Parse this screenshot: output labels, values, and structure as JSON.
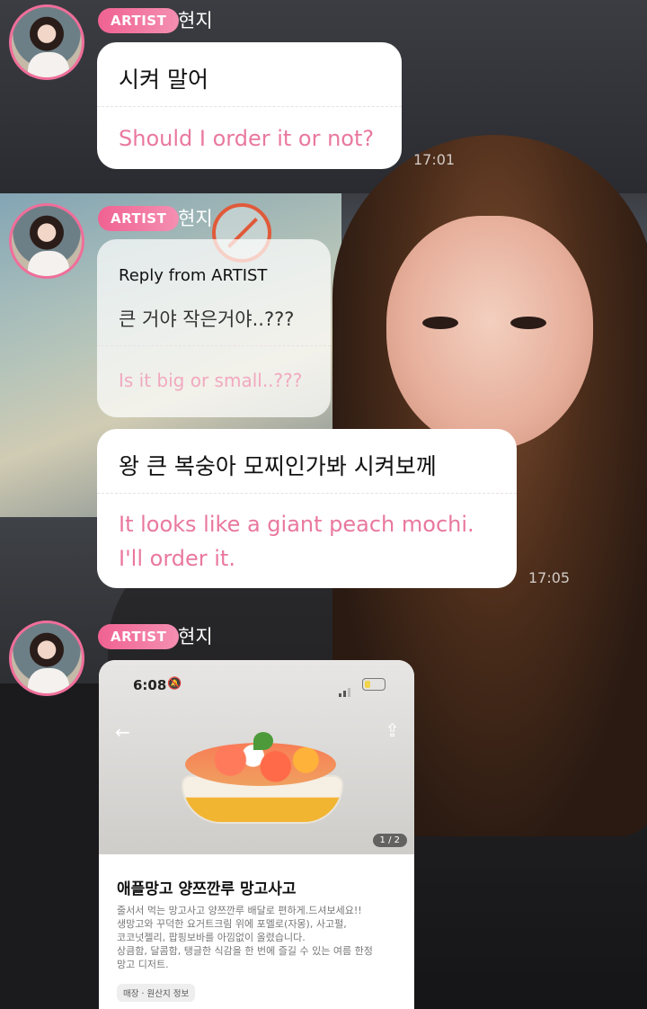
{
  "artist_badge": "ARTIST",
  "artist_name": "현지",
  "messages": [
    {
      "ko": "시켜 말어",
      "en": "Should I order it or not?",
      "time": "17:01"
    },
    {
      "reply_header": "Reply from ARTIST",
      "ko": "큰 거야 작은거야..???",
      "en": "Is it big or small..???"
    },
    {
      "ko": "왕 큰 복숭아 모찌인가봐 시켜보께",
      "en_line1": "It looks like a giant peach mochi.",
      "en_line2": "I'll order it.",
      "time": "17:05"
    }
  ],
  "card": {
    "status_time": "6:08",
    "pager": "1 / 2",
    "title": "애플망고 양쯔깐루 망고사고",
    "desc_lines": [
      "줄서서 먹는 망고사고 양쯔깐루 배달로 편하게.드셔보세요!!",
      "생망고와 꾸덕한 요거트크림 위에 포멜로(자몽), 사고펄,",
      "코코넛젤리, 팝핑보바를 아낌없이 올렸습니다.",
      "상큼함, 달콤함, 탱글한 식감을 한 번에 즐길 수 있는 여름 한정",
      "망고 디저트."
    ],
    "tag": "매장 · 원산지 정보"
  },
  "colors": {
    "accent": "#f06292",
    "translation": "#e9789e"
  }
}
